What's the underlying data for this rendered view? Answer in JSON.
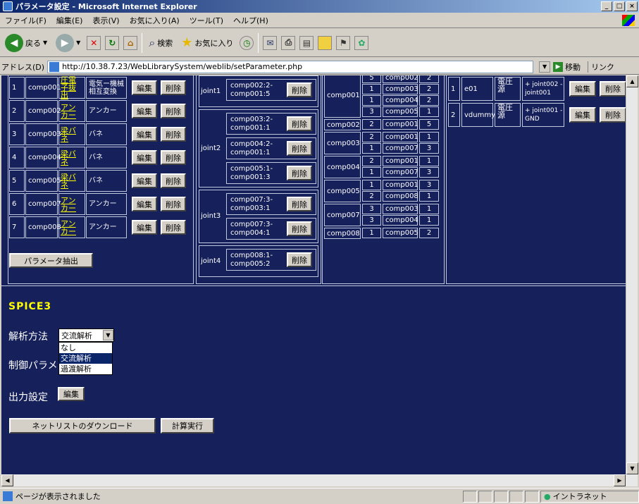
{
  "window": {
    "title": "パラメータ設定 - Microsoft Internet Explorer"
  },
  "menu": [
    "ファイル(F)",
    "編集(E)",
    "表示(V)",
    "お気に入り(A)",
    "ツール(T)",
    "ヘルプ(H)"
  ],
  "toolbar": {
    "back": "戻る",
    "search": "検索",
    "favorites": "お気に入り"
  },
  "address": {
    "label": "アドレス(D)",
    "url": "http://10.38.7.23/WebLibrarySystem/weblib/setParameter.php",
    "go": "移動",
    "links": "リンク"
  },
  "components": {
    "edit_label": "編集",
    "delete_label": "削除",
    "rows": [
      {
        "no": "1",
        "id": "comp001",
        "type": "圧電子抜出",
        "desc": "電気ー機械相互変換"
      },
      {
        "no": "2",
        "id": "comp002",
        "type": "アンカー",
        "desc": "アンカー"
      },
      {
        "no": "3",
        "id": "comp003",
        "type": "梁バネ",
        "desc": "バネ"
      },
      {
        "no": "4",
        "id": "comp004",
        "type": "梁バネ",
        "desc": "バネ"
      },
      {
        "no": "5",
        "id": "comp005",
        "type": "梁バネ",
        "desc": "バネ"
      },
      {
        "no": "6",
        "id": "comp007",
        "type": "アンカー",
        "desc": "アンカー"
      },
      {
        "no": "7",
        "id": "comp008",
        "type": "アンカー",
        "desc": "アンカー"
      }
    ],
    "extract_button": "パラメータ抽出"
  },
  "joints": {
    "delete_label": "削除",
    "groups": [
      {
        "name": "joint1",
        "items": [
          [
            "comp002:2-",
            "comp001:5"
          ]
        ]
      },
      {
        "name": "joint2",
        "items": [
          [
            "comp003:2-",
            "comp001:1"
          ],
          [
            "comp004:2-",
            "comp001:1"
          ],
          [
            "comp005:1-",
            "comp001:3"
          ]
        ]
      },
      {
        "name": "joint3",
        "items": [
          [
            "comp007:3-",
            "comp003:1"
          ],
          [
            "comp007:3-",
            "comp004:1"
          ]
        ]
      },
      {
        "name": "joint4",
        "items": [
          [
            "comp008:1-",
            "comp005:2"
          ]
        ]
      }
    ]
  },
  "connections": {
    "groups": [
      {
        "comp": "comp001",
        "rows": [
          [
            "5",
            "comp002",
            "2"
          ],
          [
            "1",
            "comp003",
            "2"
          ],
          [
            "1",
            "comp004",
            "2"
          ],
          [
            "3",
            "comp005",
            "1"
          ]
        ]
      },
      {
        "comp": "comp002",
        "rows": [
          [
            "2",
            "comp001",
            "5"
          ]
        ]
      },
      {
        "comp": "comp003",
        "rows": [
          [
            "2",
            "comp001",
            "1"
          ],
          [
            "1",
            "comp007",
            "3"
          ]
        ]
      },
      {
        "comp": "comp004",
        "rows": [
          [
            "2",
            "comp001",
            "1"
          ],
          [
            "1",
            "comp007",
            "3"
          ]
        ]
      },
      {
        "comp": "comp005",
        "rows": [
          [
            "1",
            "comp001",
            "3"
          ],
          [
            "2",
            "comp008",
            "1"
          ]
        ]
      },
      {
        "comp": "comp007",
        "rows": [
          [
            "3",
            "comp003",
            "1"
          ],
          [
            "3",
            "comp004",
            "1"
          ]
        ]
      },
      {
        "comp": "comp008",
        "rows": [
          [
            "1",
            "comp005",
            "2"
          ]
        ]
      }
    ]
  },
  "sources": {
    "rows": [
      {
        "no": "1",
        "id": "e01",
        "type": "電圧源",
        "nodes": "+ joint002 - joint001"
      },
      {
        "no": "2",
        "id": "vdummy",
        "type": "電圧源",
        "nodes": "+ joint001 - GND"
      }
    ]
  },
  "spice": {
    "heading": "SPICE3",
    "analysis_label": "解析方法",
    "analysis_value": "交流解析",
    "options": [
      "なし",
      "交流解析",
      "過渡解析"
    ],
    "control_label": "制御パラメ",
    "output_label": "出力設定",
    "output_button": "編集",
    "download_button": "ネットリストのダウンロード",
    "run_button": "計算実行"
  },
  "status": {
    "text": "ページが表示されました",
    "zone": "イントラネット"
  }
}
